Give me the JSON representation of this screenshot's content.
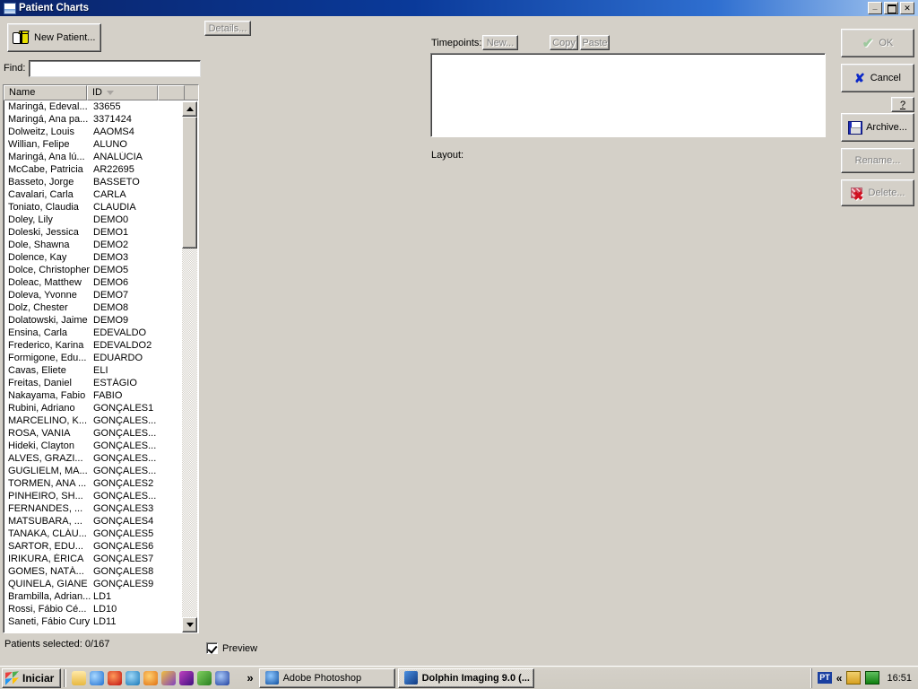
{
  "window": {
    "title": "Patient Charts",
    "icon": "chart-window-icon",
    "minimize_label": "Minimize",
    "maximize_label": "Maximize",
    "close_label": "Close"
  },
  "toolbar": {
    "new_patient_label": "New Patient...",
    "new_patient_icon": "open-book-icon",
    "details_label": "Details..."
  },
  "find": {
    "label": "Find:",
    "value": "",
    "placeholder": ""
  },
  "list": {
    "columns": [
      "Name",
      "ID",
      ""
    ],
    "sort_column": "ID",
    "sort_direction": "descending",
    "rows": [
      {
        "name": "Maringá, Edeval...",
        "id": "33655"
      },
      {
        "name": "Maringá, Ana pa...",
        "id": "3371424"
      },
      {
        "name": "Dolweitz, Louis",
        "id": "AAOMS4"
      },
      {
        "name": "Willian, Felipe",
        "id": "ALUNO"
      },
      {
        "name": "Maringá, Ana lú...",
        "id": "ANALÚCIA"
      },
      {
        "name": "McCabe, Patricia",
        "id": "AR22695"
      },
      {
        "name": "Basseto, Jorge",
        "id": "BASSETO"
      },
      {
        "name": "Cavalari, Carla",
        "id": "CARLA"
      },
      {
        "name": "Toniato, Claudia",
        "id": "CLAUDIA"
      },
      {
        "name": "Doley, Lily",
        "id": "DEMO0"
      },
      {
        "name": "Doleski, Jessica",
        "id": "DEMO1"
      },
      {
        "name": "Dole, Shawna",
        "id": "DEMO2"
      },
      {
        "name": "Dolence, Kay",
        "id": "DEMO3"
      },
      {
        "name": "Dolce, Christopher",
        "id": "DEMO5"
      },
      {
        "name": "Doleac, Matthew",
        "id": "DEMO6"
      },
      {
        "name": "Doleva, Yvonne",
        "id": "DEMO7"
      },
      {
        "name": "Dolz, Chester",
        "id": "DEMO8"
      },
      {
        "name": "Dolatowski, Jaime",
        "id": "DEMO9"
      },
      {
        "name": "Ensina, Carla",
        "id": "EDEVALDO"
      },
      {
        "name": "Frederico, Karina",
        "id": "EDEVALDO2"
      },
      {
        "name": "Formigone, Edu...",
        "id": "EDUARDO"
      },
      {
        "name": "Cavas, Eliete",
        "id": "ELI"
      },
      {
        "name": "Freitas, Daniel",
        "id": "ESTÁGIO"
      },
      {
        "name": "Nakayama, Fabio",
        "id": "FABIO"
      },
      {
        "name": "Rubini, Adriano",
        "id": "GONÇALES1"
      },
      {
        "name": "MARCELINO, K...",
        "id": "GONÇALES..."
      },
      {
        "name": "ROSA, VANIA",
        "id": "GONÇALES..."
      },
      {
        "name": "Hideki, Clayton",
        "id": "GONÇALES..."
      },
      {
        "name": "ALVES, GRAZI...",
        "id": "GONÇALES..."
      },
      {
        "name": "GUGLIELM, MA...",
        "id": "GONÇALES..."
      },
      {
        "name": "TORMEN, ANA ...",
        "id": "GONÇALES2"
      },
      {
        "name": "PINHEIRO, SH...",
        "id": "GONÇALES..."
      },
      {
        "name": "FERNANDES, ...",
        "id": "GONÇALES3"
      },
      {
        "name": "MATSUBARA, ...",
        "id": "GONÇALES4"
      },
      {
        "name": "TANAKA, CLÁU...",
        "id": "GONÇALES5"
      },
      {
        "name": "SARTOR, EDU...",
        "id": "GONÇALES6"
      },
      {
        "name": "IRIKURA, ÉRICA",
        "id": "GONÇALES7"
      },
      {
        "name": "GOMES, NATÁ...",
        "id": "GONÇALES8"
      },
      {
        "name": "QUINELA, GIANE",
        "id": "GONÇALES9"
      },
      {
        "name": "Brambilla, Adrian...",
        "id": "LD1"
      },
      {
        "name": "Rossi, Fábio Cé...",
        "id": "LD10"
      },
      {
        "name": "Saneti, Fábio Cury",
        "id": "LD11"
      }
    ]
  },
  "status": {
    "patients_selected": "Patients selected: 0/167",
    "preview_label": "Preview",
    "preview_checked": true
  },
  "timepoints": {
    "label": "Timepoints:",
    "new_label": "New...",
    "copy_label": "Copy",
    "paste_label": "Paste",
    "layout_label": "Layout:",
    "items": []
  },
  "actions": {
    "ok_label": "OK",
    "ok_icon": "green-check-icon",
    "cancel_label": "Cancel",
    "cancel_icon": "blue-x-icon",
    "help_label": "?",
    "archive_label": "Archive...",
    "archive_icon": "floppy-disk-icon",
    "rename_label": "Rename...",
    "delete_label": "Delete...",
    "delete_icon": "delete-chart-icon"
  },
  "taskbar": {
    "start_label": "Iniciar",
    "quicklaunch": [
      "show-desktop-icon",
      "internet-explorer-icon",
      "nero-burning-icon",
      "quicktime-icon",
      "media-player-icon",
      "winamp-icon",
      "video-tools-icon",
      "image-tools-icon",
      "vlc-icon"
    ],
    "overflow_label": "»",
    "tasks": [
      {
        "label": "Adobe Photoshop",
        "icon": "photoshop-icon",
        "active": false
      },
      {
        "label": "Dolphin Imaging 9.0 (...",
        "icon": "dolphin-icon",
        "active": true
      }
    ],
    "tray": {
      "language": "PT",
      "expand_label": "«",
      "icons": [
        "network-icon",
        "volume-icon"
      ],
      "clock": "16:51"
    }
  },
  "colors": {
    "title_start": "#0a246a",
    "title_end": "#a6c8f0",
    "face": "#d4d0c8",
    "field": "#ffffff",
    "disabled_text": "#808080",
    "accent_blue": "#1a3fa0"
  }
}
